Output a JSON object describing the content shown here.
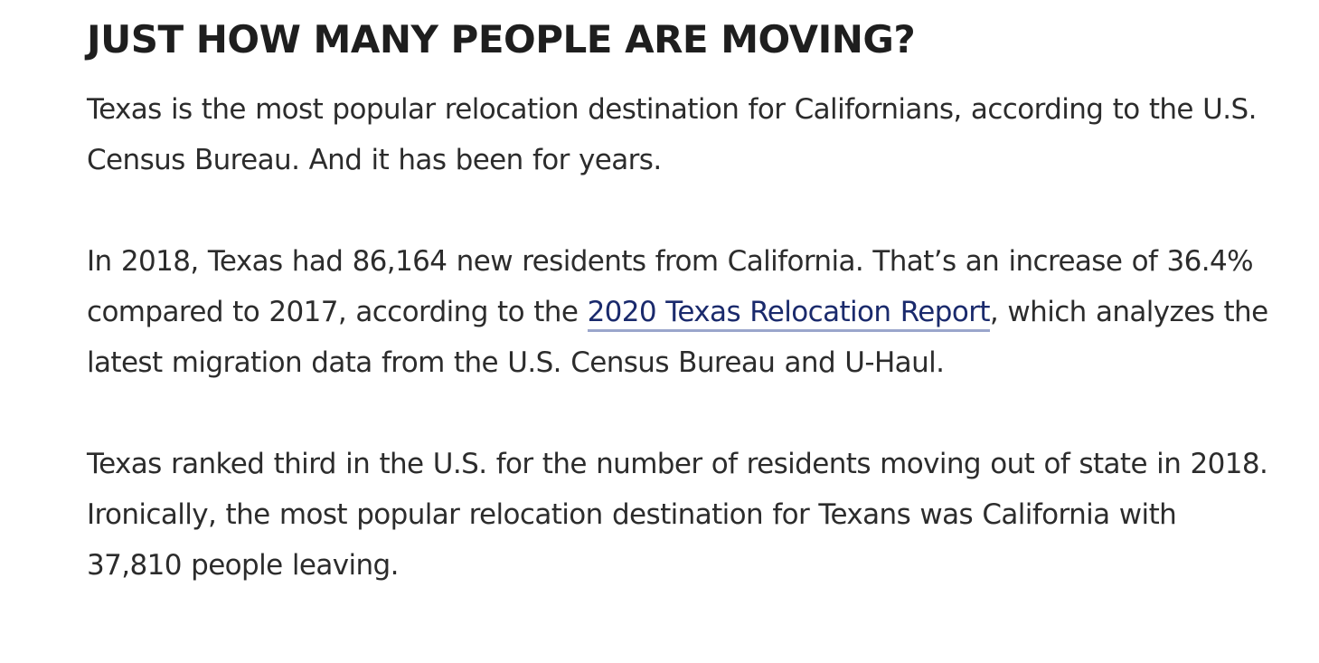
{
  "article": {
    "heading": "JUST HOW MANY PEOPLE ARE MOVING?",
    "paragraph1": {
      "text": "Texas is the most popular relocation destination for Californians, according to the U.S. Census Bureau. And it has been for years."
    },
    "paragraph2": {
      "before": "In 2018, Texas had 86,164 new residents from California. That’s an increase of 36.4% compared to 2017, according to the ",
      "link_text": "2020 Texas Relocation Report",
      "after": ", which analyzes the latest migration data from the U.S. Census Bureau and U-Haul."
    },
    "paragraph3": {
      "text": "Texas ranked third in the U.S. for the number of residents moving out of state in 2018. Ironically, the most popular relocation destination for Texans was California with 37,810 people leaving."
    }
  },
  "colors": {
    "text": "#2c2c2c",
    "heading": "#1e1e1e",
    "link": "#1a2a6c",
    "link_underline": "#9aa6cc",
    "background": "#ffffff"
  }
}
